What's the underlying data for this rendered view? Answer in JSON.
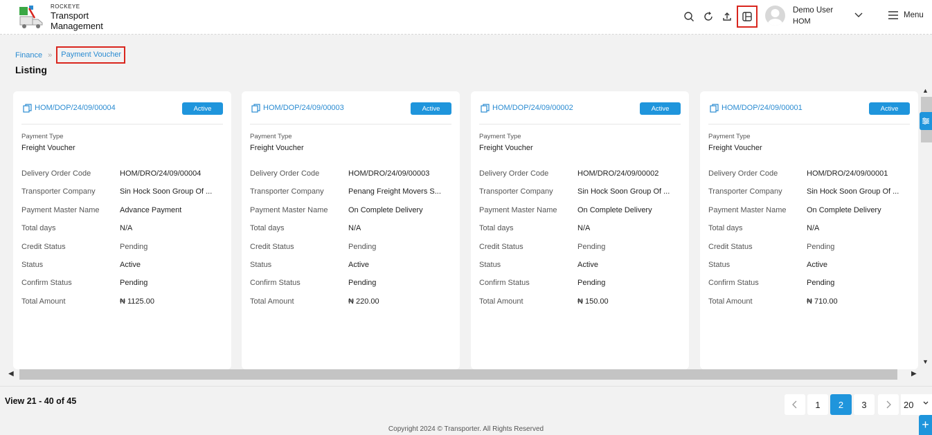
{
  "brand": {
    "small": "ROCKEYE",
    "line1": "Transport",
    "line2": "Management"
  },
  "header": {
    "icons": [
      "search-icon",
      "refresh-icon",
      "upload-icon",
      "layout-icon"
    ],
    "user_name": "Demo User",
    "user_org": "HOM",
    "menu_label": "Menu"
  },
  "breadcrumb": {
    "parent": "Finance",
    "current": "Payment Voucher"
  },
  "page_title": "Listing",
  "field_labels": {
    "payment_type": "Payment Type",
    "delivery_order_code": "Delivery Order Code",
    "transporter_company": "Transporter Company",
    "payment_master_name": "Payment Master Name",
    "total_days": "Total days",
    "credit_status": "Credit Status",
    "status": "Status",
    "confirm_status": "Confirm Status",
    "total_amount": "Total Amount"
  },
  "cards": [
    {
      "code": "HOM/DOP/24/09/00004",
      "badge": "Active",
      "payment_type": "Freight Voucher",
      "delivery_order_code": "HOM/DRO/24/09/00004",
      "transporter_company": "Sin Hock Soon Group Of ...",
      "payment_master_name": "Advance Payment",
      "total_days": "N/A",
      "credit_status": "Pending",
      "status": "Active",
      "confirm_status": "Pending",
      "total_amount": "₦ 1125.00"
    },
    {
      "code": "HOM/DOP/24/09/00003",
      "badge": "Active",
      "payment_type": "Freight Voucher",
      "delivery_order_code": "HOM/DRO/24/09/00003",
      "transporter_company": "Penang Freight Movers S...",
      "payment_master_name": "On Complete Delivery",
      "total_days": "N/A",
      "credit_status": "Pending",
      "status": "Active",
      "confirm_status": "Pending",
      "total_amount": "₦ 220.00"
    },
    {
      "code": "HOM/DOP/24/09/00002",
      "badge": "Active",
      "payment_type": "Freight Voucher",
      "delivery_order_code": "HOM/DRO/24/09/00002",
      "transporter_company": "Sin Hock Soon Group Of ...",
      "payment_master_name": "On Complete Delivery",
      "total_days": "N/A",
      "credit_status": "Pending",
      "status": "Active",
      "confirm_status": "Pending",
      "total_amount": "₦ 150.00"
    },
    {
      "code": "HOM/DOP/24/09/00001",
      "badge": "Active",
      "payment_type": "Freight Voucher",
      "delivery_order_code": "HOM/DRO/24/09/00001",
      "transporter_company": "Sin Hock Soon Group Of ...",
      "payment_master_name": "On Complete Delivery",
      "total_days": "N/A",
      "credit_status": "Pending",
      "status": "Active",
      "confirm_status": "Pending",
      "total_amount": "₦ 710.00"
    }
  ],
  "pagination": {
    "view_text": "View 21 - 40 of 45",
    "pages": [
      "1",
      "2",
      "3"
    ],
    "current_page": "2",
    "page_size": "20"
  },
  "copyright": "Copyright 2024 © Transporter. All Rights Reserved",
  "colors": {
    "accent": "#1f95dc",
    "link": "#2a8bd1",
    "highlight": "#d9251d"
  }
}
